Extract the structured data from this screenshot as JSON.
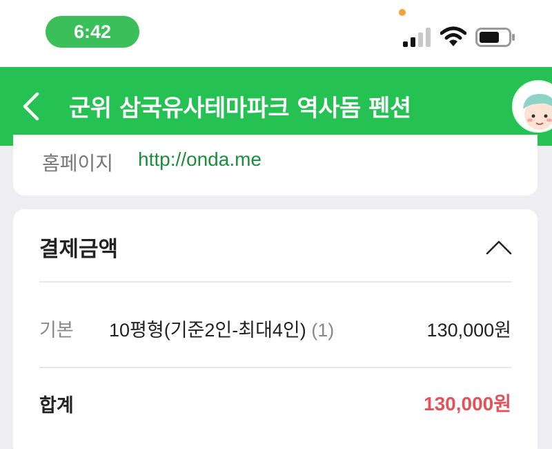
{
  "status_bar": {
    "time": "6:42",
    "signal_icon": "cellular-signal-icon",
    "wifi_icon": "wifi-icon",
    "battery_icon": "battery-icon",
    "accent_color": "#3bbf5a",
    "indicator_color": "#f4a23a"
  },
  "header": {
    "title": "군위 삼국유사테마파크 역사돔 펜션",
    "back_icon": "chevron-left-icon",
    "avatar_icon": "user-avatar-icon",
    "background_color": "#25c153"
  },
  "info_card": {
    "homepage_label": "홈페이지",
    "homepage_url": "http://onda.me"
  },
  "payment": {
    "title": "결제금액",
    "toggle_icon": "chevron-up-icon",
    "items": [
      {
        "label": "기본",
        "description": "10평형(기준2인-최대4인)",
        "quantity": "(1)",
        "amount": "130,000원"
      }
    ],
    "total_label": "합계",
    "total_amount": "130,000원",
    "total_color": "#e0535a"
  }
}
